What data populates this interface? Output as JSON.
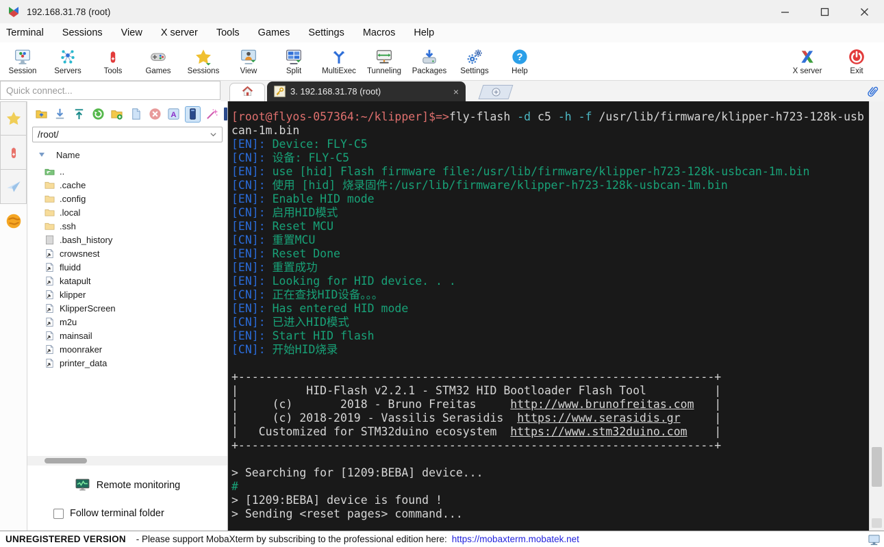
{
  "window": {
    "title": "192.168.31.78 (root)"
  },
  "menubar": {
    "items": [
      "Terminal",
      "Sessions",
      "View",
      "X server",
      "Tools",
      "Games",
      "Settings",
      "Macros",
      "Help"
    ]
  },
  "toolbar": {
    "items": [
      {
        "label": "Session",
        "icon": "session"
      },
      {
        "label": "Servers",
        "icon": "servers"
      },
      {
        "label": "Tools",
        "icon": "tools"
      },
      {
        "label": "Games",
        "icon": "games"
      },
      {
        "label": "Sessions",
        "icon": "sessions-star"
      },
      {
        "label": "View",
        "icon": "view"
      },
      {
        "label": "Split",
        "icon": "split"
      },
      {
        "label": "MultiExec",
        "icon": "multiexec"
      },
      {
        "label": "Tunneling",
        "icon": "tunneling"
      },
      {
        "label": "Packages",
        "icon": "packages"
      },
      {
        "label": "Settings",
        "icon": "settings"
      },
      {
        "label": "Help",
        "icon": "help"
      }
    ],
    "right_items": [
      {
        "label": "X server",
        "icon": "xserver"
      },
      {
        "label": "Exit",
        "icon": "exit"
      }
    ]
  },
  "quick_connect": {
    "placeholder": "Quick connect..."
  },
  "tabs": {
    "active_label": "3. 192.168.31.78 (root)",
    "close_glyph": "×"
  },
  "sidebar": {
    "toolbar": [
      {
        "name": "parent-dir-icon"
      },
      {
        "name": "download-icon"
      },
      {
        "name": "upload-icon"
      },
      {
        "name": "refresh-icon"
      },
      {
        "name": "new-folder-icon"
      },
      {
        "name": "new-file-icon"
      },
      {
        "name": "delete-icon"
      },
      {
        "name": "rename-icon"
      },
      {
        "name": "terminal-follow-icon",
        "selected": true
      },
      {
        "name": "wand-icon"
      }
    ],
    "path": "/root/",
    "name_header": "Name",
    "files": [
      {
        "name": "..",
        "icon": "folder-up"
      },
      {
        "name": ".cache",
        "icon": "folder"
      },
      {
        "name": ".config",
        "icon": "folder"
      },
      {
        "name": ".local",
        "icon": "folder"
      },
      {
        "name": ".ssh",
        "icon": "folder"
      },
      {
        "name": ".bash_history",
        "icon": "file"
      },
      {
        "name": "crowsnest",
        "icon": "symlink"
      },
      {
        "name": "fluidd",
        "icon": "symlink"
      },
      {
        "name": "katapult",
        "icon": "symlink"
      },
      {
        "name": "klipper",
        "icon": "symlink"
      },
      {
        "name": "KlipperScreen",
        "icon": "symlink"
      },
      {
        "name": "m2u",
        "icon": "symlink"
      },
      {
        "name": "mainsail",
        "icon": "symlink"
      },
      {
        "name": "moonraker",
        "icon": "symlink"
      },
      {
        "name": "printer_data",
        "icon": "symlink"
      }
    ],
    "remote_monitoring": "Remote monitoring",
    "follow_label": "Follow terminal folder"
  },
  "colors": {
    "prompt": "#e0706e",
    "flag": "#4db8c4",
    "white": "#d6d6d6",
    "tag": "#2a6bd8",
    "msg": "#18a278",
    "terminal_bg": "#191919",
    "link_blue": "#2222dd"
  },
  "terminal": {
    "lines": [
      [
        {
          "t": "[root@flyos-057364:~/klipper]$=>",
          "c": "prompt"
        },
        {
          "t": "fly-flash ",
          "c": "white"
        },
        {
          "t": "-d",
          "c": "flag"
        },
        {
          "t": " c5 ",
          "c": "white"
        },
        {
          "t": "-h",
          "c": "flag"
        },
        {
          "t": " ",
          "c": "white"
        },
        {
          "t": "-f",
          "c": "flag"
        },
        {
          "t": " /usr/lib/firmware/klipper-h723-128k-usb",
          "c": "white"
        }
      ],
      [
        {
          "t": "can-1m.bin",
          "c": "white"
        }
      ],
      [
        {
          "t": "[EN]: ",
          "c": "tag"
        },
        {
          "t": "Device: FLY-C5",
          "c": "msg"
        }
      ],
      [
        {
          "t": "[CN]: ",
          "c": "tag"
        },
        {
          "t": "设备: FLY-C5",
          "c": "msg"
        }
      ],
      [
        {
          "t": "[EN]: ",
          "c": "tag"
        },
        {
          "t": "use [hid] Flash firmware file:/usr/lib/firmware/klipper-h723-128k-usbcan-1m.bin",
          "c": "msg"
        }
      ],
      [
        {
          "t": "[CN]: ",
          "c": "tag"
        },
        {
          "t": "使用 [hid] 烧录固件:/usr/lib/firmware/klipper-h723-128k-usbcan-1m.bin",
          "c": "msg"
        }
      ],
      [
        {
          "t": "[EN]: ",
          "c": "tag"
        },
        {
          "t": "Enable HID mode",
          "c": "msg"
        }
      ],
      [
        {
          "t": "[CN]: ",
          "c": "tag"
        },
        {
          "t": "启用HID模式",
          "c": "msg"
        }
      ],
      [
        {
          "t": "[EN]: ",
          "c": "tag"
        },
        {
          "t": "Reset MCU",
          "c": "msg"
        }
      ],
      [
        {
          "t": "[CN]: ",
          "c": "tag"
        },
        {
          "t": "重置MCU",
          "c": "msg"
        }
      ],
      [
        {
          "t": "[EN]: ",
          "c": "tag"
        },
        {
          "t": "Reset Done",
          "c": "msg"
        }
      ],
      [
        {
          "t": "[EN]: ",
          "c": "tag"
        },
        {
          "t": "重置成功",
          "c": "msg"
        }
      ],
      [
        {
          "t": "[EN]: ",
          "c": "tag"
        },
        {
          "t": "Looking for HID device. . .",
          "c": "msg"
        }
      ],
      [
        {
          "t": "[CN]: ",
          "c": "tag"
        },
        {
          "t": "正在查找HID设备。。。",
          "c": "msg"
        }
      ],
      [
        {
          "t": "[EN]: ",
          "c": "tag"
        },
        {
          "t": "Has entered HID mode",
          "c": "msg"
        }
      ],
      [
        {
          "t": "[CN]: ",
          "c": "tag"
        },
        {
          "t": "已进入HID模式",
          "c": "msg"
        }
      ],
      [
        {
          "t": "[EN]: ",
          "c": "tag"
        },
        {
          "t": "Start HID flash",
          "c": "msg"
        }
      ],
      [
        {
          "t": "[CN]: ",
          "c": "tag"
        },
        {
          "t": "开始HID烧录",
          "c": "msg"
        }
      ],
      [],
      [
        {
          "t": "+----------------------------------------------------------------------+",
          "c": "white"
        }
      ],
      [
        {
          "t": "|          HID-Flash v2.2.1 - STM32 HID Bootloader Flash Tool          |",
          "c": "white"
        }
      ],
      [
        {
          "t": "|     (c)       2018 - Bruno Freitas     ",
          "c": "white"
        },
        {
          "t": "http://www.brunofreitas.com",
          "c": "white",
          "u": true,
          "link": true
        },
        {
          "t": "   |",
          "c": "white"
        }
      ],
      [
        {
          "t": "|     (c) 2018-2019 - Vassilis Serasidis  ",
          "c": "white"
        },
        {
          "t": "https://www.serasidis.gr",
          "c": "white",
          "u": true,
          "link": true
        },
        {
          "t": "     |",
          "c": "white"
        }
      ],
      [
        {
          "t": "|   Customized for STM32duino ecosystem  ",
          "c": "white"
        },
        {
          "t": "https://www.stm32duino.com",
          "c": "white",
          "u": true,
          "link": true
        },
        {
          "t": "    |",
          "c": "white"
        }
      ],
      [
        {
          "t": "+----------------------------------------------------------------------+",
          "c": "white"
        }
      ],
      [],
      [
        {
          "t": "> Searching for [1209:BEBA] device...",
          "c": "white"
        }
      ],
      [
        {
          "t": "#",
          "c": "msg"
        }
      ],
      [
        {
          "t": "> [1209:BEBA] device is found !",
          "c": "white"
        }
      ],
      [
        {
          "t": "> Sending <reset pages> command...",
          "c": "white"
        }
      ]
    ]
  },
  "statusbar": {
    "unregistered": "UNREGISTERED VERSION",
    "message": "-  Please support MobaXterm by subscribing to the professional edition here:",
    "link": "https://mobaxterm.mobatek.net"
  }
}
